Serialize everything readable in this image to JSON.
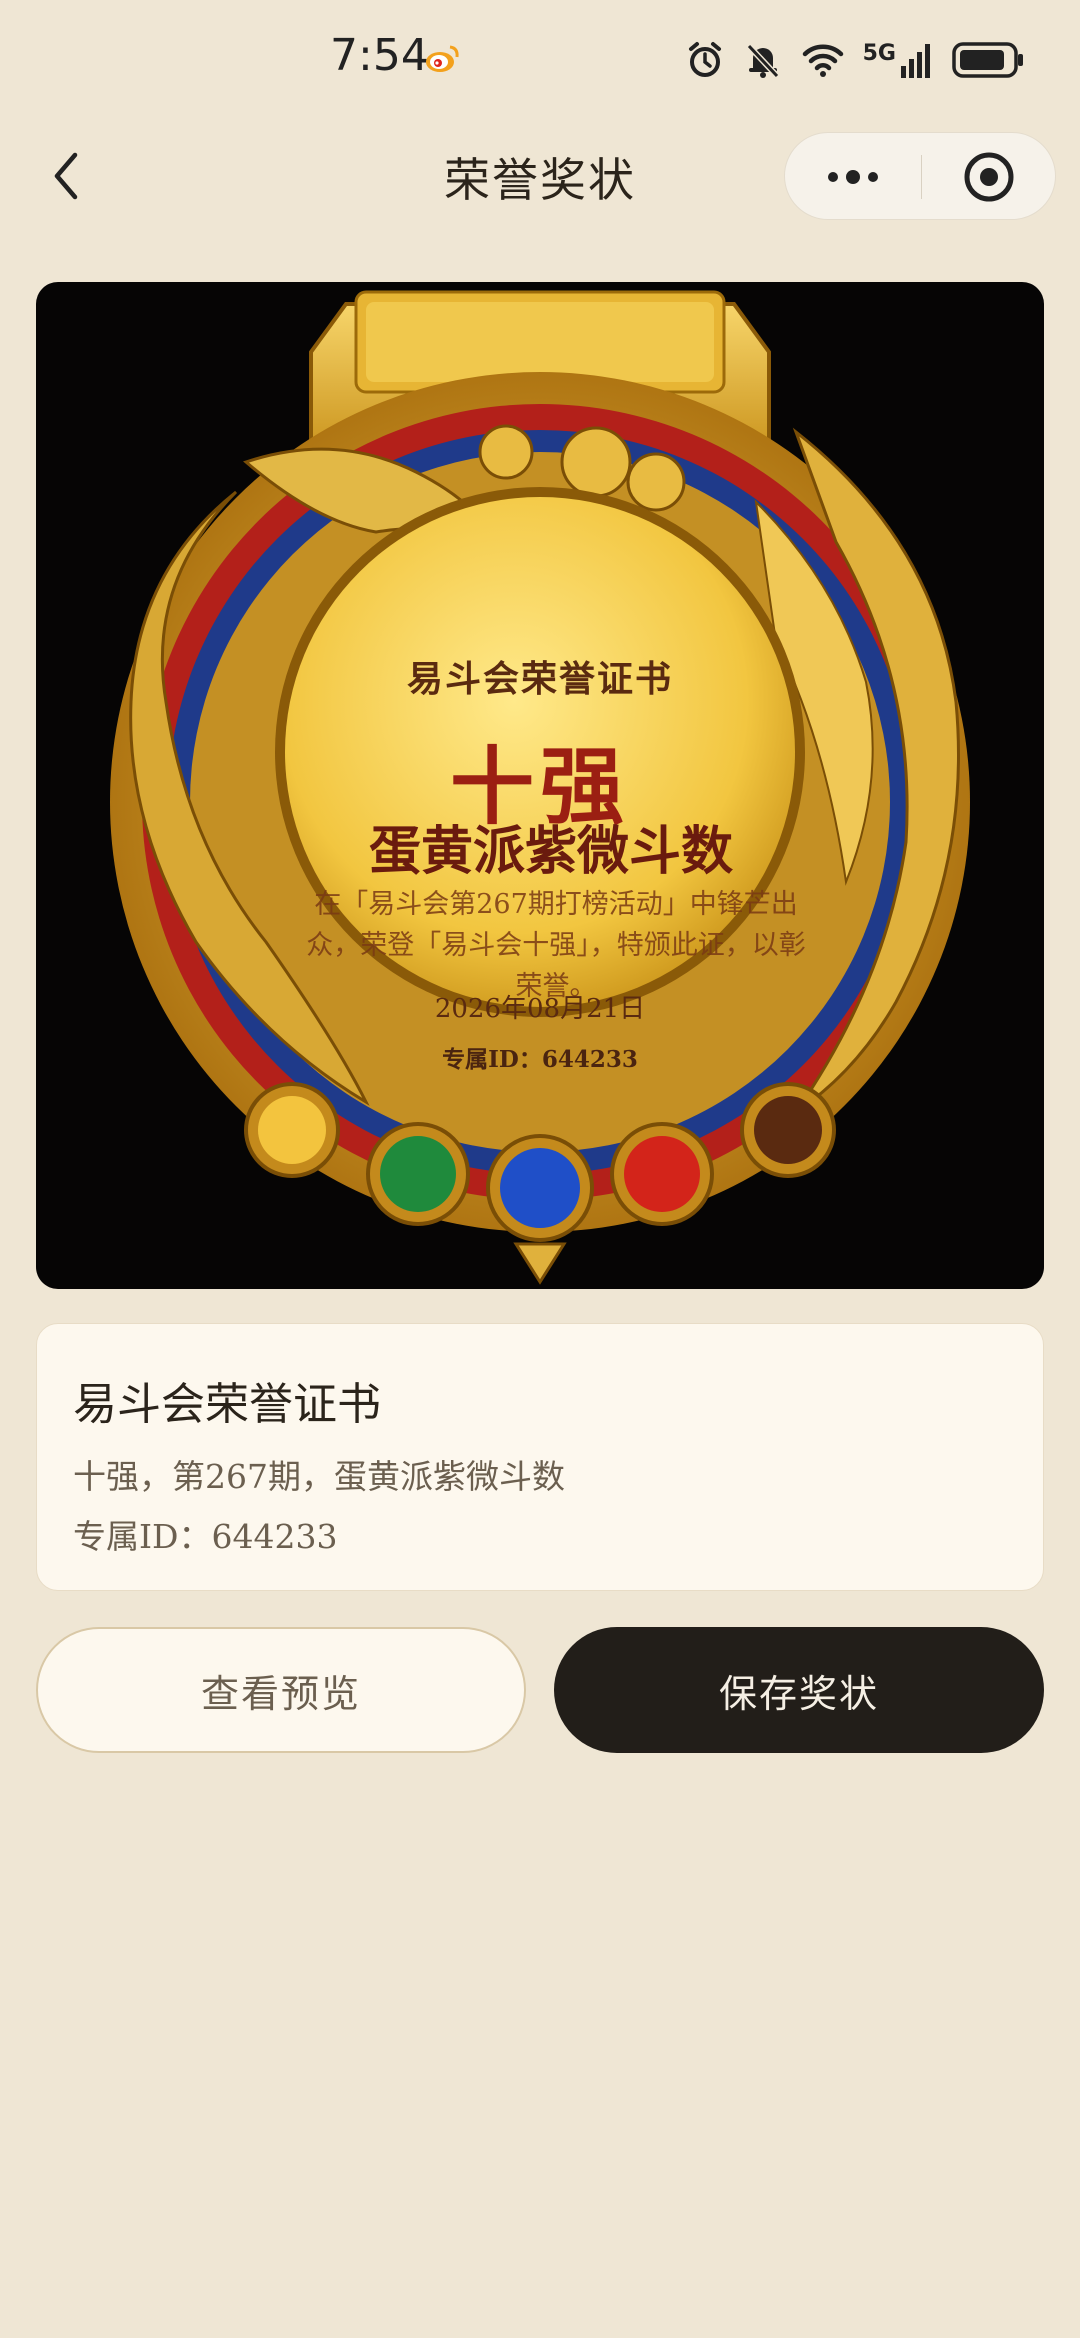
{
  "status_bar": {
    "time": "7:54",
    "network": "5G"
  },
  "nav": {
    "title": "荣誉奖状"
  },
  "medal": {
    "cert_title": "易斗会荣誉证书",
    "rank": "十强",
    "name": "蛋黄派紫微斗数",
    "description": "在「易斗会第267期打榜活动」中锋芒出众，荣登「易斗会十强」，特颁此证，以彰荣誉。",
    "date": "2026年08月21日",
    "exclusive_id": "专属ID：644233"
  },
  "info_card": {
    "title": "易斗会荣誉证书",
    "line1": "十强，第267期，蛋黄派紫微斗数",
    "line2": "专属ID：644233"
  },
  "buttons": {
    "preview_label": "查看预览",
    "save_label": "保存奖状"
  },
  "colors": {
    "background": "#efe6d4",
    "card": "#fdf8ee",
    "primary_button": "#221e19",
    "gold": "#e8b72a",
    "crimson": "#9b1f12"
  },
  "icons": {
    "back": "chevron-left-icon",
    "more": "more-dots-icon",
    "close": "target-close-icon"
  }
}
